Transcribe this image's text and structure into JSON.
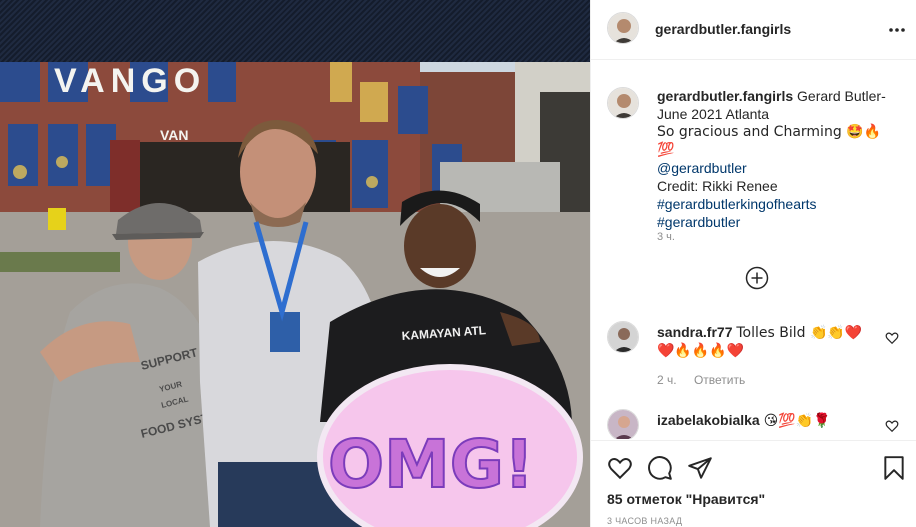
{
  "post": {
    "username": "gerardbutler.fangirls",
    "photo_sign_text": "VANGO",
    "photo_sign_text_small": "VAN",
    "photo_shirt_text_1": "KAMAYAN ATL",
    "photo_shirt_text_2": "SUPPORT",
    "photo_shirt_text_3": "YOUR",
    "photo_shirt_text_4": "LOCAL",
    "photo_shirt_text_5": "FOOD SYSTEM",
    "photo_sticker_text": "OMG!"
  },
  "caption": {
    "username": "gerardbutler.fangirls",
    "text_line1": "Gerard Butler-",
    "text_line2": "June 2021 Atlanta",
    "text_line3": "So gracious and Charming 🤩🔥💯",
    "mention": "@gerardbutler",
    "credit": "Credit: Rikki Renee",
    "hashtag1": "#gerardbutlerkingofhearts",
    "hashtag2": "#gerardbutler",
    "time": "3 ч."
  },
  "comments": [
    {
      "username": "sandra.fr77",
      "text": "Tolles Bild 👏👏❤️",
      "text_line2": "❤️🔥🔥🔥❤️",
      "time": "2 ч.",
      "reply_label": "Ответить"
    },
    {
      "username": "izabelakobialka",
      "text": "😘💯👏🌹"
    }
  ],
  "actions": {
    "likes": "85 отметок \"Нравится\"",
    "posted": "3 ЧАСОВ НАЗАД"
  },
  "icons": {
    "more": "more-horizontal-icon",
    "add": "add-circle-icon",
    "like": "heart-icon",
    "comment": "comment-icon",
    "share": "share-icon",
    "save": "bookmark-icon"
  },
  "colors": {
    "link": "#00376b",
    "muted": "#8e8e8e",
    "text": "#262626",
    "border": "#efefef"
  }
}
